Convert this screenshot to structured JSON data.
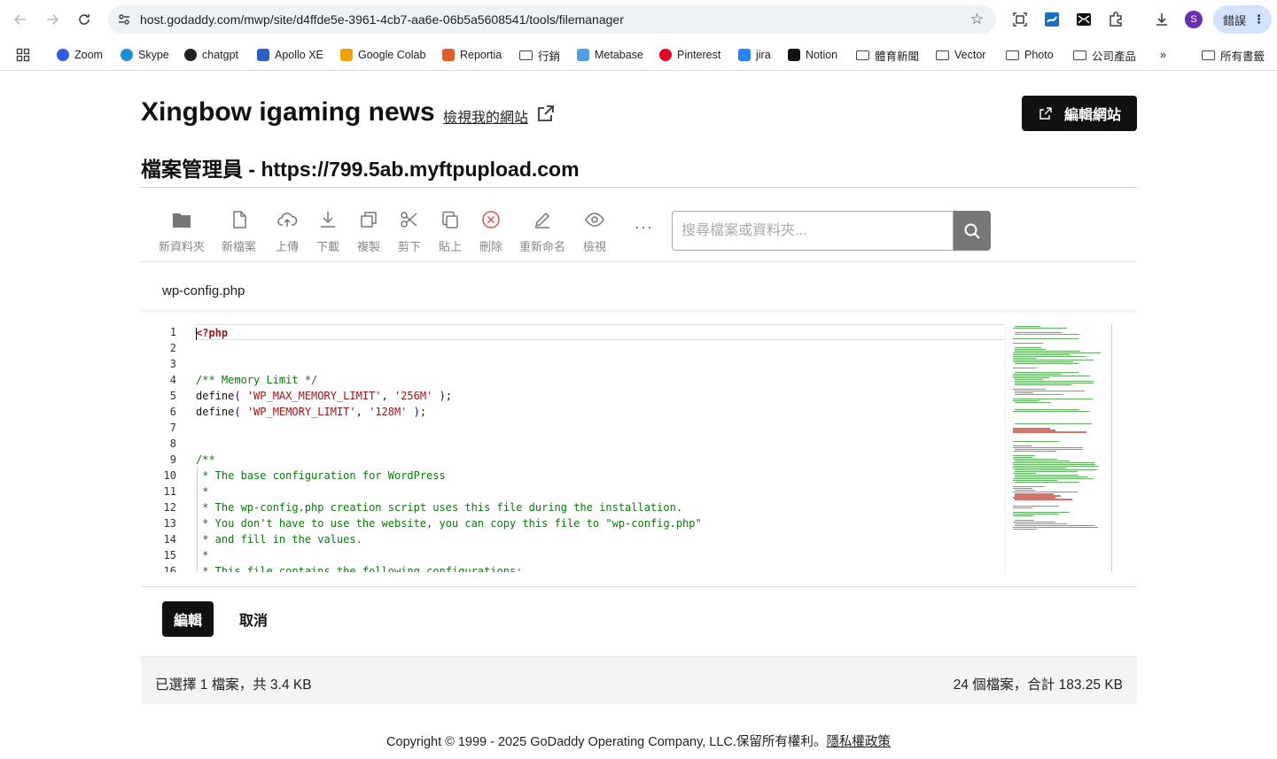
{
  "browser": {
    "url": "host.godaddy.com/mwp/site/d4ffde5e-3961-4cb7-aa6e-06b5a5608541/tools/filemanager",
    "error_label": "錯誤",
    "avatar_letter": "S",
    "bookmarks": [
      {
        "label": "Zoom",
        "icon": "zoom-icon",
        "color": "#2d5de8"
      },
      {
        "label": "Skype",
        "icon": "skype-icon",
        "color": "#1a8fd8"
      },
      {
        "label": "chatgpt",
        "icon": "chatgpt-icon",
        "color": "#222222"
      },
      {
        "label": "Apollo XE",
        "icon": "apollo-icon",
        "color": "#2b62c9"
      },
      {
        "label": "Google Colab",
        "icon": "colab-icon",
        "color": "#f2a100"
      },
      {
        "label": "Reportia",
        "icon": "reportia-icon",
        "color": "#e05a2b"
      },
      {
        "label": "行銷",
        "icon": "folder-icon"
      },
      {
        "label": "Metabase",
        "icon": "metabase-icon",
        "color": "#509ee3"
      },
      {
        "label": "Pinterest",
        "icon": "pinterest-icon",
        "color": "#e60023"
      },
      {
        "label": "jira",
        "icon": "jira-icon",
        "color": "#2684ff"
      },
      {
        "label": "Notion",
        "icon": "notion-icon",
        "color": "#111111"
      },
      {
        "label": "體育新聞",
        "icon": "folder-icon"
      },
      {
        "label": "Vector",
        "icon": "folder-icon"
      },
      {
        "label": "Photo",
        "icon": "folder-icon"
      },
      {
        "label": "公司產品",
        "icon": "folder-icon"
      }
    ],
    "all_bookmarks_label": "所有書籤",
    "overflow_label": "»"
  },
  "header": {
    "site_title": "Xingbow igaming news",
    "view_site_label": "檢視我的網站",
    "edit_site_label": "編輯網站",
    "file_manager_title": "檔案管理員 - https://799.5ab.myftpupload.com"
  },
  "toolbar": {
    "items": [
      {
        "label": "新資料夾",
        "icon": "folder-icon"
      },
      {
        "label": "新檔案",
        "icon": "file-icon"
      },
      {
        "label": "上傳",
        "icon": "upload-icon"
      },
      {
        "label": "下載",
        "icon": "download-icon"
      },
      {
        "label": "複製",
        "icon": "copy-icon"
      },
      {
        "label": "剪下",
        "icon": "scissors-icon"
      },
      {
        "label": "貼上",
        "icon": "paste-icon"
      },
      {
        "label": "刪除",
        "icon": "delete-icon"
      },
      {
        "label": "重新命名",
        "icon": "pencil-icon"
      },
      {
        "label": "檢視",
        "icon": "eye-icon"
      }
    ],
    "more_label": "···",
    "search_placeholder": "搜尋檔案或資料夾..."
  },
  "file": {
    "name": "wp-config.php",
    "lines": [
      {
        "n": "1",
        "text": "<?php"
      },
      {
        "n": "2",
        "text": ""
      },
      {
        "n": "3",
        "text": ""
      },
      {
        "n": "4",
        "text": "/** Memory Limit */"
      },
      {
        "n": "5",
        "text": "define( 'WP_MAX_MEMORY_LIMIT', '256M' );"
      },
      {
        "n": "6",
        "text": "define( 'WP_MEMORY_LIMIT', '128M' );"
      },
      {
        "n": "7",
        "text": ""
      },
      {
        "n": "8",
        "text": ""
      },
      {
        "n": "9",
        "text": "/**"
      },
      {
        "n": "10",
        "text": " * The base configuration for WordPress"
      },
      {
        "n": "11",
        "text": " *"
      },
      {
        "n": "12",
        "text": " * The wp-config.php creation script uses this file during the installation."
      },
      {
        "n": "13",
        "text": " * You don't have to use the website, you can copy this file to \"wp-config.php\""
      },
      {
        "n": "14",
        "text": " * and fill in the values."
      },
      {
        "n": "15",
        "text": " *"
      },
      {
        "n": "16",
        "text": " * This file contains the following configurations:"
      }
    ]
  },
  "actions": {
    "edit_label": "編輯",
    "cancel_label": "取消"
  },
  "status": {
    "selected": "已選擇 1 檔案，共 3.4 KB",
    "total": "24 個檔案，合計 183.25 KB"
  },
  "footer": {
    "copyright": "Copyright © 1999 - 2025 GoDaddy Operating Company, LLC.保留所有權利。",
    "privacy_label": "隱私權政策"
  }
}
